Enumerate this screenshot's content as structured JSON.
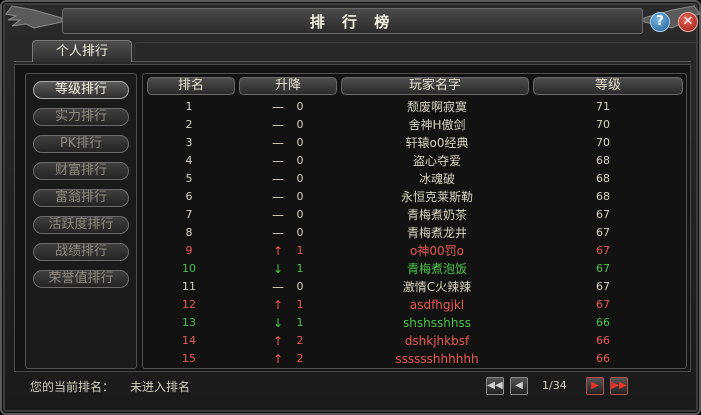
{
  "window": {
    "title": "排 行 榜"
  },
  "tabs": [
    {
      "label": "个人排行"
    }
  ],
  "categories": [
    {
      "label": "等级排行",
      "active": true
    },
    {
      "label": "实力排行",
      "active": false
    },
    {
      "label": "PK排行",
      "active": false
    },
    {
      "label": "财富排行",
      "active": false
    },
    {
      "label": "富翁排行",
      "active": false
    },
    {
      "label": "活跃度排行",
      "active": false
    },
    {
      "label": "战绩排行",
      "active": false
    },
    {
      "label": "荣誉值排行",
      "active": false
    }
  ],
  "table": {
    "headers": {
      "rank": "排名",
      "change": "升降",
      "name": "玩家名字",
      "level": "等级"
    },
    "rows": [
      {
        "rank": "1",
        "arrow": "—",
        "change": "0",
        "name": "颓废啊寂寞",
        "level": "71",
        "color": "#d8d2c0"
      },
      {
        "rank": "2",
        "arrow": "—",
        "change": "0",
        "name": "舍神H傲剑",
        "level": "70",
        "color": "#d8d2c0"
      },
      {
        "rank": "3",
        "arrow": "—",
        "change": "0",
        "name": "轩辕o0经典",
        "level": "70",
        "color": "#d8d2c0"
      },
      {
        "rank": "4",
        "arrow": "—",
        "change": "0",
        "name": "盗心夺爱",
        "level": "68",
        "color": "#d8d2c0"
      },
      {
        "rank": "5",
        "arrow": "—",
        "change": "0",
        "name": "冰魂破",
        "level": "68",
        "color": "#d8d2c0"
      },
      {
        "rank": "6",
        "arrow": "—",
        "change": "0",
        "name": "永恒克莱斯勒",
        "level": "68",
        "color": "#d8d2c0"
      },
      {
        "rank": "7",
        "arrow": "—",
        "change": "0",
        "name": "青梅煮奶茶",
        "level": "67",
        "color": "#d8d2c0"
      },
      {
        "rank": "8",
        "arrow": "—",
        "change": "0",
        "name": "青梅煮龙井",
        "level": "67",
        "color": "#d8d2c0"
      },
      {
        "rank": "9",
        "arrow": "↑",
        "change": "1",
        "name": "o神00罚o",
        "level": "67",
        "color": "#e85a52"
      },
      {
        "rank": "10",
        "arrow": "↓",
        "change": "1",
        "name": "青梅煮泡饭",
        "level": "67",
        "color": "#4cc24c"
      },
      {
        "rank": "11",
        "arrow": "—",
        "change": "0",
        "name": "激情C火辣辣",
        "level": "67",
        "color": "#d8d2c0"
      },
      {
        "rank": "12",
        "arrow": "↑",
        "change": "1",
        "name": "asdfhgjkl",
        "level": "67",
        "color": "#e85a52"
      },
      {
        "rank": "13",
        "arrow": "↓",
        "change": "1",
        "name": "shshsshhss",
        "level": "66",
        "color": "#4cc24c"
      },
      {
        "rank": "14",
        "arrow": "↑",
        "change": "2",
        "name": "dshkjhkbsf",
        "level": "66",
        "color": "#e85a52"
      },
      {
        "rank": "15",
        "arrow": "↑",
        "change": "2",
        "name": "sssssshhhhhh",
        "level": "66",
        "color": "#e85a52"
      }
    ]
  },
  "footer": {
    "label": "您的当前排名：",
    "value": "未进入排名"
  },
  "pagination": {
    "page": "1/34"
  },
  "icons": {
    "help": "?",
    "close": "✕",
    "first": "◀◀",
    "prev": "◀",
    "next": "▶",
    "last": "▶▶"
  },
  "colors": {
    "up": "#e85a52",
    "down": "#4cc24c",
    "normal": "#d8d2c0"
  }
}
